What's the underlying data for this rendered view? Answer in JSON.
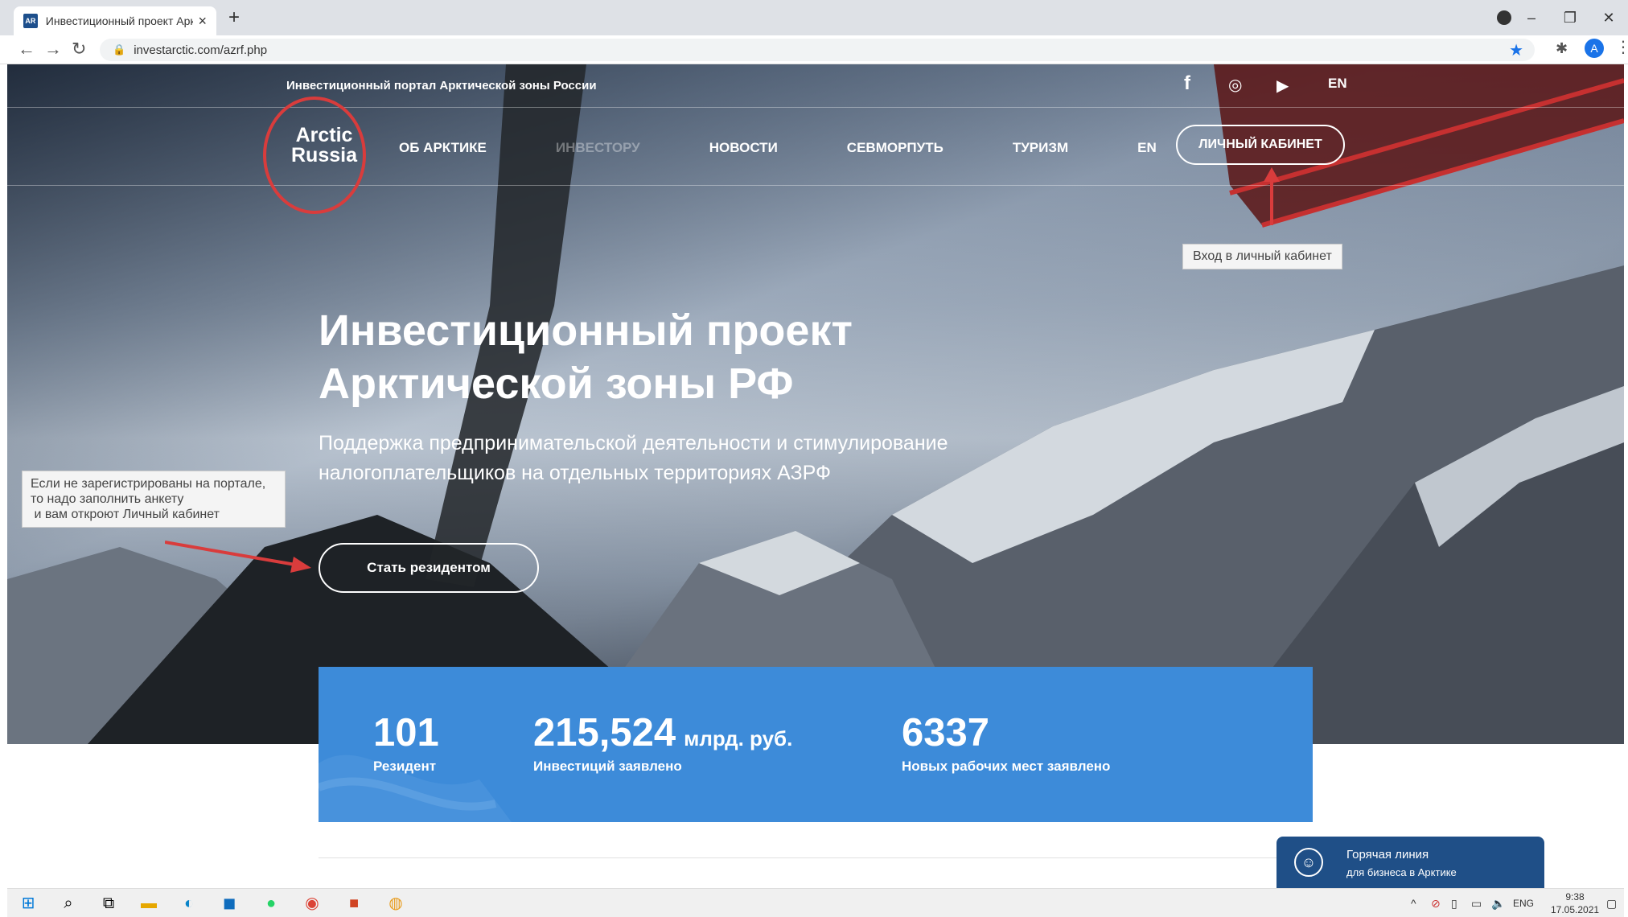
{
  "browser": {
    "tab_title": "Инвестиционный проект Аркти",
    "favicon_text": "AR",
    "url": "investarctic.com/azrf.php",
    "avatar_letter": "A"
  },
  "site": {
    "topbar_text": "Инвестиционный портал Арктической зоны России",
    "lang_top": "EN",
    "social_icons": [
      "facebook-icon",
      "instagram-icon",
      "youtube-icon"
    ],
    "logo_line1": "Arctic",
    "logo_line2": "Russia",
    "nav": {
      "about": "ОБ АРКТИКЕ",
      "investor": "ИНВЕСТОРУ",
      "news": "НОВОСТИ",
      "sevmorput": "СЕВМОРПУТЬ",
      "tourism": "ТУРИЗМ",
      "lang": "EN"
    },
    "cabinet_button": "ЛИЧНЫЙ КАБИНЕТ",
    "hero_title_1": "Инвестиционный проект",
    "hero_title_2": "Арктической зоны РФ",
    "hero_sub_1": "Поддержка предпринимательской деятельности и стимулирование",
    "hero_sub_2": "налогоплательщиков на отдельных территориях АЗРФ",
    "resident_button": "Стать резидентом",
    "stats": {
      "residents_value": "101",
      "residents_label": "Резидент",
      "investments_value": "215,524",
      "investments_unit": "млрд. руб.",
      "investments_label": "Инвестиций заявлено",
      "jobs_value": "6337",
      "jobs_label": "Новых рабочих мест заявлено"
    },
    "hotline_title": "Горячая линия",
    "hotline_sub": "для бизнеса в Арктике"
  },
  "annotations": {
    "cabinet_hint": "Вход в личный кабинет",
    "register_hint_1": "Если не зарегистрированы на портале,",
    "register_hint_2": "то надо заполнить анкету",
    "register_hint_3": " и вам откроют Личный кабинет",
    "marker_color": "#d93c3c"
  },
  "taskbar": {
    "lang": "ENG",
    "time": "9:38",
    "date": "17.05.2021"
  }
}
